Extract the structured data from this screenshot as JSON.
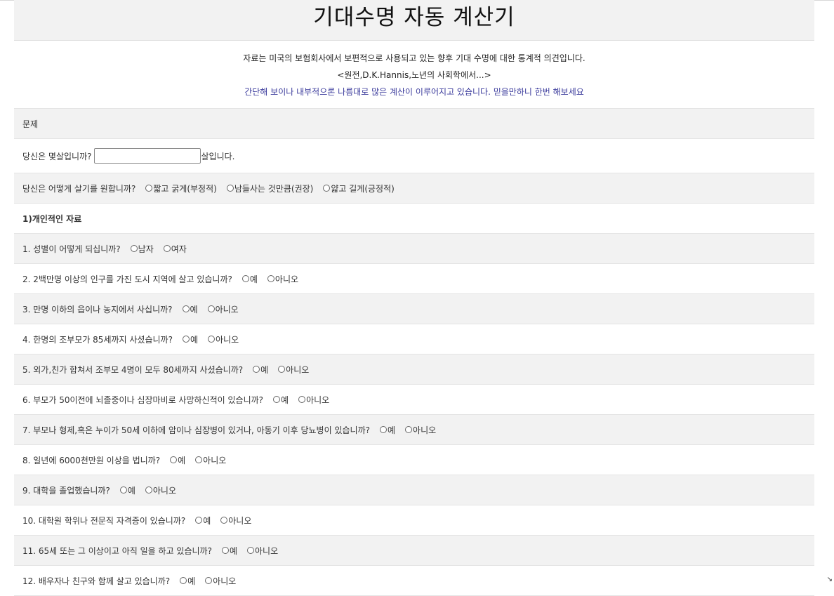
{
  "title": "기대수명 자동 계산기",
  "intro": {
    "line1": "자료는 미국의 보험회사에서 보편적으로 사용되고 있는 향후 기대 수명에 대한 통계적 의견입니다.",
    "line2": "<원전,D.K.Hannis,노년의 사회학에서...>",
    "line3": "간단해 보이나 내부적으론 나름대로 많은 계산이 이루어지고 있습니다. 믿을만하니 한번 해보세요"
  },
  "section_header": "문제",
  "age": {
    "label": "당신은 몇살입니까?",
    "value": "",
    "suffix": "살입니다."
  },
  "lifestyle": {
    "label": "당신은 어떻게 살기를 원합니까?",
    "options": [
      "짧고 굵게(부정적)",
      "남들사는 것만큼(권장)",
      "얇고 길게(긍정적)"
    ]
  },
  "personal_header": "1)개인적인 자료",
  "questions": [
    {
      "text": "1. 성별이 어떻게 되십니까?",
      "options": [
        "남자",
        "여자"
      ]
    },
    {
      "text": "2. 2백만명 이상의 인구를 가진 도시 지역에 살고 있습니까?",
      "options": [
        "예",
        "아니오"
      ]
    },
    {
      "text": "3. 만명 이하의 읍이나 농지에서 사십니까?",
      "options": [
        "예",
        "아니오"
      ]
    },
    {
      "text": "4. 한명의 조부모가 85세까지 사셨습니까?",
      "options": [
        "예",
        "아니오"
      ]
    },
    {
      "text": "5. 외가,친가 합쳐서 조부모 4명이 모두 80세까지 사셨습니까?",
      "options": [
        "예",
        "아니오"
      ]
    },
    {
      "text": "6. 부모가 50이전에 뇌졸중이나 심장마비로 사망하신적이 있습니까?",
      "options": [
        "예",
        "아니오"
      ]
    },
    {
      "text": "7. 부모나 형제,혹은 누이가 50세 이하에 암이나 심장병이 있거나, 아동기 이후 당뇨병이 있습니까?",
      "options": [
        "예",
        "아니오"
      ]
    },
    {
      "text": "8. 일년에 6000천만원 이상을 법니까?",
      "options": [
        "예",
        "아니오"
      ]
    },
    {
      "text": "9. 대학을 졸업했습니까?",
      "options": [
        "예",
        "아니오"
      ]
    },
    {
      "text": "10. 대학원 학위나 전문직 자격증이 있습니까?",
      "options": [
        "예",
        "아니오"
      ]
    },
    {
      "text": "11. 65세 또는 그 이상이고 아직 일을 하고 있습니까?",
      "options": [
        "예",
        "아니오"
      ]
    },
    {
      "text": "12. 배우자나 친구와 함께 살고 있습니까?",
      "options": [
        "예",
        "아니오"
      ]
    }
  ]
}
